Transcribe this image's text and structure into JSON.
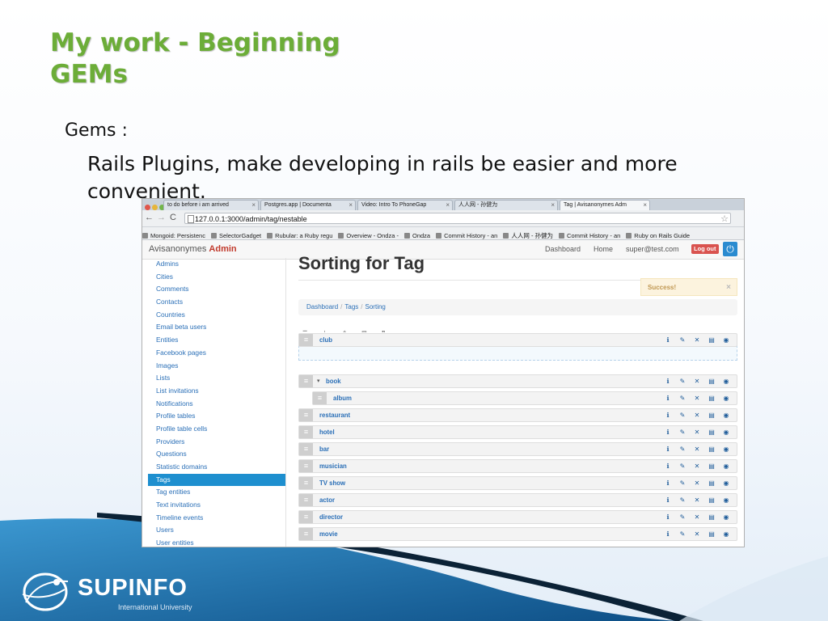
{
  "slide": {
    "title_line1": "My work  - Beginning",
    "title_line2": "GEMs",
    "bullet_term": "Gems",
    "bullet_term_suffix": " :",
    "bullet_text": "Rails Plugins, make developing in rails be easier and more convenient.",
    "logo_text": "SUPINFO",
    "logo_subtext": "International University"
  },
  "browser": {
    "tabs": [
      {
        "label": "to do before i am arrived"
      },
      {
        "label": "Postgres.app | Documenta"
      },
      {
        "label": "Video: Intro To PhoneGap"
      },
      {
        "label": "人人网 - 孙健为"
      },
      {
        "label": "Tag | Avisanonymes Adm",
        "active": true
      }
    ],
    "url": "127.0.0.1:3000/admin/tag/nestable",
    "bookmarks": [
      "Mongoid: Persistenc",
      "SelectorGadget",
      "Rubular: a Ruby regu",
      "Overview - Ondza -",
      "Ondza",
      "Commit History - an",
      "人人网 - 孙健为",
      "Commit History - an",
      "Ruby on Rails Guide"
    ]
  },
  "app": {
    "brand_name": "Avisanonymes",
    "brand_admin": "Admin",
    "nav": {
      "dashboard": "Dashboard",
      "home": "Home",
      "user_email": "super@test.com",
      "logout": "Log out"
    },
    "sidebar": [
      {
        "label": "Admins"
      },
      {
        "label": "Cities"
      },
      {
        "label": "Comments"
      },
      {
        "label": "Contacts"
      },
      {
        "label": "Countries"
      },
      {
        "label": "Email beta users"
      },
      {
        "label": "Entities"
      },
      {
        "label": "Facebook pages"
      },
      {
        "label": "Images"
      },
      {
        "label": "Lists"
      },
      {
        "label": "List invitations"
      },
      {
        "label": "Notifications"
      },
      {
        "label": "Profile tables"
      },
      {
        "label": "Profile table cells"
      },
      {
        "label": "Providers"
      },
      {
        "label": "Questions"
      },
      {
        "label": "Statistic domains"
      },
      {
        "label": "Tags",
        "active": true
      },
      {
        "label": "Tag entities"
      },
      {
        "label": "Text invitations"
      },
      {
        "label": "Timeline events"
      },
      {
        "label": "Users"
      },
      {
        "label": "User entities"
      }
    ],
    "page_title": "Sorting for Tag",
    "alert": "Success!",
    "breadcrumb": [
      "Dashboard",
      "Tags",
      "Sorting"
    ],
    "tree": [
      {
        "label": "club",
        "depth": 0
      },
      {
        "label": "book",
        "depth": 0,
        "collapsible": true
      },
      {
        "label": "album",
        "depth": 1
      },
      {
        "label": "restaurant",
        "depth": 0
      },
      {
        "label": "hotel",
        "depth": 0
      },
      {
        "label": "bar",
        "depth": 0
      },
      {
        "label": "musician",
        "depth": 0
      },
      {
        "label": "TV show",
        "depth": 0
      },
      {
        "label": "actor",
        "depth": 0
      },
      {
        "label": "director",
        "depth": 0
      },
      {
        "label": "movie",
        "depth": 0
      }
    ],
    "row_actions": [
      "info-icon",
      "edit-icon",
      "delete-icon",
      "history-icon",
      "show-icon"
    ]
  },
  "colors": {
    "title_green": "#6cad38",
    "sidebar_active": "#1e8fcf",
    "logout_red": "#d9534f",
    "footer_blue": "#1c6fae"
  }
}
